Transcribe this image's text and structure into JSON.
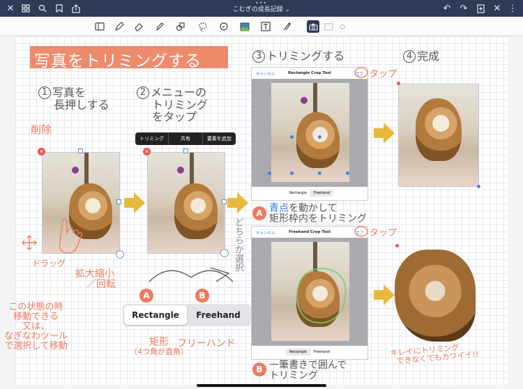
{
  "window": {
    "title": "こむぎの成長記録",
    "icons": [
      "close-icon",
      "grid-icon",
      "search-icon",
      "bookmark-icon",
      "share-icon",
      "undo-icon",
      "redo-icon",
      "add-page-icon",
      "close-x-icon"
    ]
  },
  "toolbar": {
    "tools": [
      "reader-icon",
      "pen-icon",
      "eraser-icon",
      "highlighter-icon",
      "shape-icon",
      "lasso-icon",
      "sticker-icon",
      "image-icon",
      "text-icon",
      "laser-icon",
      "camera-icon",
      "photo-dim-icon",
      "more-dim-icon"
    ]
  },
  "note": {
    "title": "写真をトリミングする",
    "step1": {
      "num": "1",
      "line1": "写真を",
      "line2": "長押しする"
    },
    "step2": {
      "num": "2",
      "line1": "メニューの",
      "line2": "トリミング",
      "line3": "をタップ"
    },
    "step3": {
      "num": "3",
      "text": "トリミングする"
    },
    "step4": {
      "num": "4",
      "text": "完成"
    },
    "delete_label": "削除",
    "drag_label": "ドラッグ",
    "scale_label1": "拡大縮小",
    "scale_label2": "／回転",
    "move_note": [
      "この状態の時",
      "移動できる",
      "又は、",
      "なぎなわツール",
      "で選択して移動"
    ],
    "choose_label": "どちらか選択",
    "tap_label": "タップ",
    "tap_label2": "タップ",
    "rect_desc": {
      "line1": "矩形",
      "line2": "（4つ角が直角）"
    },
    "free_desc": "フリーハンド",
    "A_note": {
      "badge": "A",
      "blue": "青点",
      "rest": "を動かして",
      "line2": "矩形枠内をトリミング"
    },
    "B_note": {
      "badge": "B",
      "line1": "一筆書きで囲んで",
      "line2": "トリミング"
    },
    "cute_note": {
      "line1": "キレイにトリミング",
      "line2": "できなくてもカワイイ!!"
    },
    "choice_A": "A",
    "choice_B": "B"
  },
  "context_menu": {
    "items": [
      "トリミング",
      "共有",
      "要素を追加"
    ]
  },
  "crop_rect": {
    "cancel": "キャンセル",
    "title": "Rectangle Crop Tool",
    "done": "完了",
    "seg": [
      "Rectangle",
      "Freehand"
    ]
  },
  "crop_free": {
    "cancel": "キャンセル",
    "title": "Freehand Crop Tool",
    "done": "完了",
    "seg": [
      "Rectangle",
      "Freehand"
    ]
  },
  "mode_switch": {
    "rect": "Rectangle",
    "free": "Freehand"
  }
}
